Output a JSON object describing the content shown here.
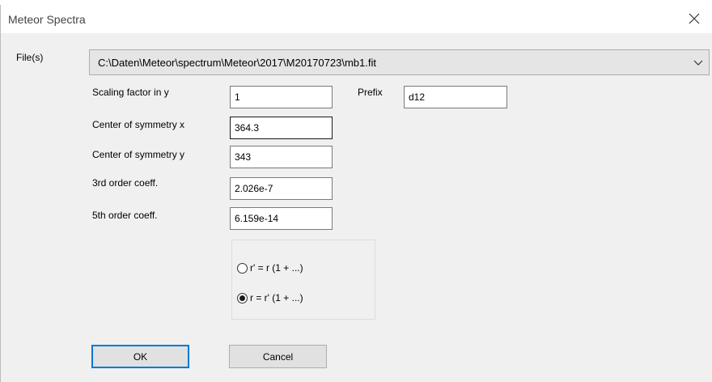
{
  "window": {
    "title": "Meteor Spectra"
  },
  "file": {
    "label": "File(s)",
    "value": "C:\\Daten\\Meteor\\spectrum\\Meteor\\2017\\M20170723\\mb1.fit"
  },
  "fields": {
    "scaling_label": "Scaling factor in y",
    "scaling_value": "1",
    "prefix_label": "Prefix",
    "prefix_value": "d12",
    "cx_label": "Center of symmetry x",
    "cx_value": "364.3",
    "cy_label": "Center of symmetry y",
    "cy_value": "343",
    "c3_label": "3rd order coeff.",
    "c3_value": "2.026e-7",
    "c5_label": "5th order coeff.",
    "c5_value": "6.159e-14"
  },
  "model": {
    "options": [
      {
        "label": "r' = r (1 + ...)",
        "selected": false
      },
      {
        "label": "r = r' (1 + ...)",
        "selected": true
      }
    ]
  },
  "buttons": {
    "ok": "OK",
    "cancel": "Cancel"
  },
  "icons": {
    "close": "close-icon",
    "dropdown": "chevron-down-icon"
  }
}
